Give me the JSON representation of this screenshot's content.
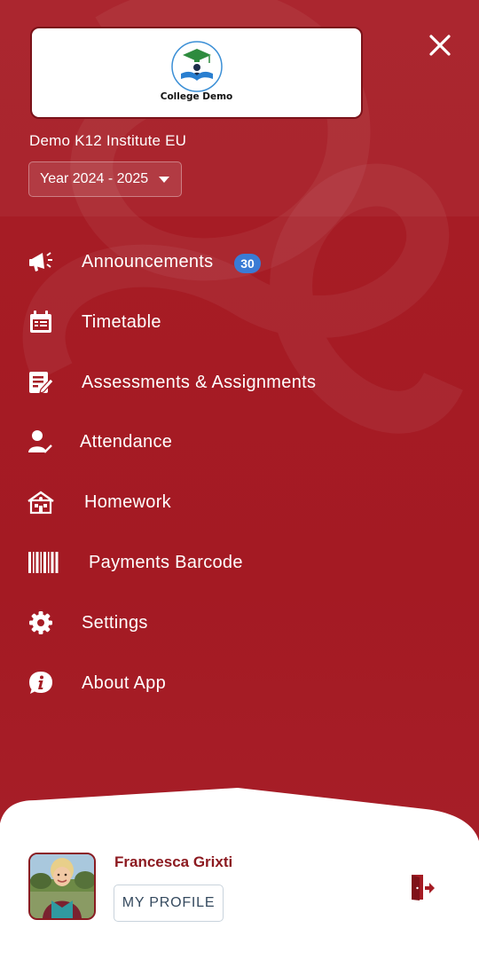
{
  "header": {
    "logo_text": "College Demo",
    "institute_name": "Demo K12 Institute EU",
    "year_selector": "Year 2024 - 2025"
  },
  "menu": {
    "items": [
      {
        "label": "Announcements",
        "icon": "megaphone-icon",
        "badge": "30"
      },
      {
        "label": "Timetable",
        "icon": "calendar-icon"
      },
      {
        "label": "Assessments & Assignments",
        "icon": "edit-document-icon"
      },
      {
        "label": "Attendance",
        "icon": "person-check-icon"
      },
      {
        "label": "Homework",
        "icon": "school-building-icon"
      },
      {
        "label": "Payments Barcode",
        "icon": "barcode-icon"
      },
      {
        "label": "Settings",
        "icon": "gear-icon"
      },
      {
        "label": "About App",
        "icon": "info-bubble-icon"
      }
    ]
  },
  "profile": {
    "name": "Francesca Grixti",
    "my_profile_label": "MY PROFILE"
  },
  "colors": {
    "primary": "#a51c24",
    "badge": "#3a7bd5",
    "name_text": "#8c1a20"
  }
}
